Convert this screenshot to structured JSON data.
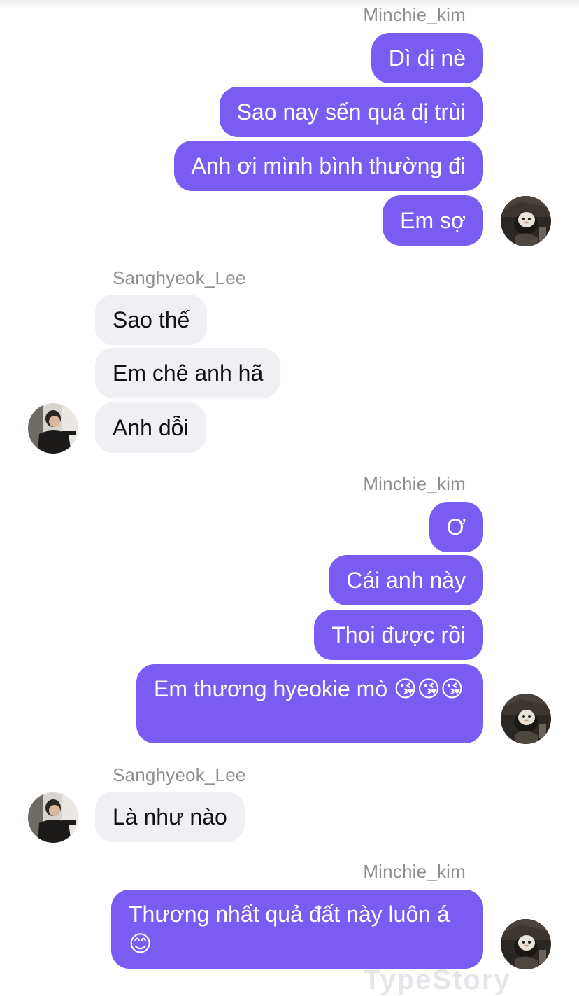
{
  "chat": {
    "watermark": "TypeStory",
    "groups": [
      {
        "side": "out",
        "sender": "Minchie_kim",
        "messages": [
          "Dì dị nè",
          "Sao nay sến quá dị trùi",
          "Anh ơi mình bình thường đi",
          "Em sợ"
        ]
      },
      {
        "side": "in",
        "sender": "Sanghyeok_Lee",
        "messages": [
          "Sao thế",
          "Em chê anh hã",
          "Anh dỗi"
        ]
      },
      {
        "side": "out",
        "sender": "Minchie_kim",
        "messages": [
          "Ơ",
          "Cái anh này",
          "Thoi được rồi",
          "Em thương hyeokie mò 😘😘😘"
        ]
      },
      {
        "side": "in",
        "sender": "Sanghyeok_Lee",
        "messages": [
          "Là như nào"
        ]
      },
      {
        "side": "out",
        "sender": "Minchie_kim",
        "messages": [
          "Thương nhất quả đất này luôn á 😊"
        ]
      }
    ]
  },
  "avatars": {
    "minchie": {
      "icon": "dark-plush-avatar-icon",
      "color": "#2b2724"
    },
    "sanghyeok": {
      "icon": "person-photo-avatar-icon",
      "color": "#d8d4cf"
    }
  },
  "colors": {
    "outgoing_bubble": "#7a5cf3",
    "incoming_bubble": "#efeff4",
    "sender_name": "#8e8e93"
  }
}
